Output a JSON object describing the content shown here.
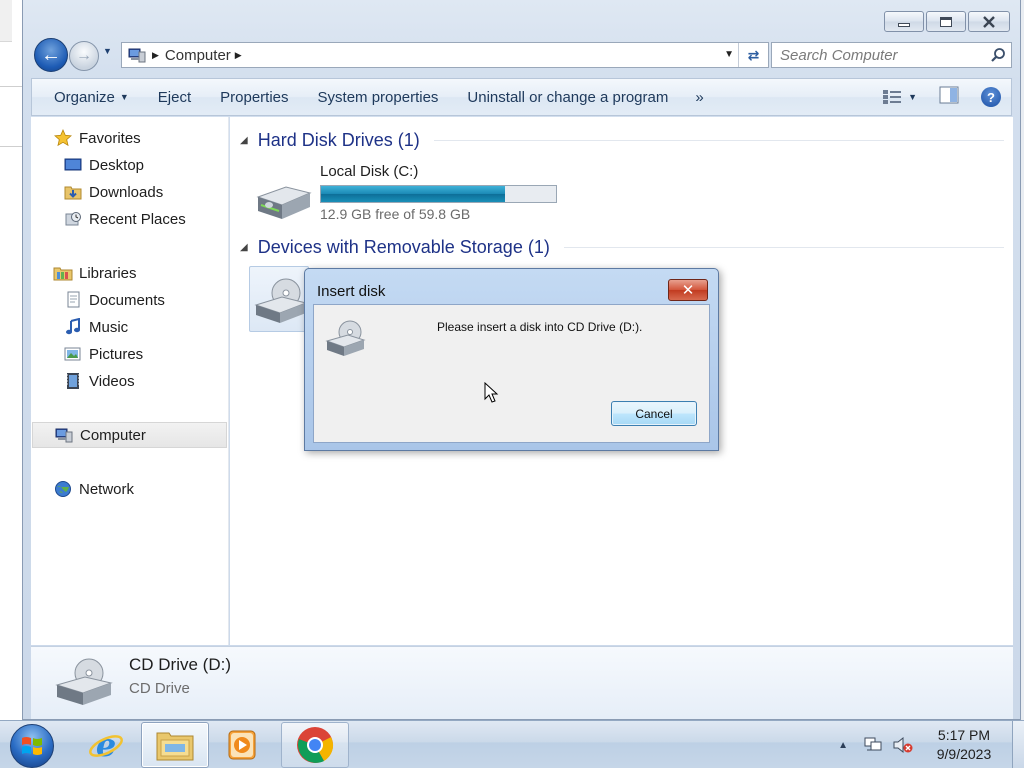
{
  "window": {
    "address": {
      "location": "Computer"
    },
    "search": {
      "placeholder": "Search Computer"
    }
  },
  "command_bar": {
    "organize": "Organize",
    "eject": "Eject",
    "properties": "Properties",
    "system_properties": "System properties",
    "uninstall": "Uninstall or change a program",
    "more": "»"
  },
  "nav": {
    "favorites": "Favorites",
    "desktop": "Desktop",
    "downloads": "Downloads",
    "recent_places": "Recent Places",
    "libraries": "Libraries",
    "documents": "Documents",
    "music": "Music",
    "pictures": "Pictures",
    "videos": "Videos",
    "computer": "Computer",
    "network": "Network"
  },
  "content": {
    "hdd_group": "Hard Disk Drives (1)",
    "removable_group": "Devices with Removable Storage (1)",
    "local_disk": {
      "name": "Local Disk (C:)",
      "free_text": "12.9 GB free of 59.8 GB",
      "used_fraction": 0.784
    }
  },
  "details": {
    "name": "CD Drive (D:)",
    "type": "CD Drive"
  },
  "dialog": {
    "title": "Insert disk",
    "close_glyph": "✕",
    "message": "Please insert a disk into CD Drive (D:).",
    "cancel": "Cancel"
  },
  "taskbar": {
    "time": "5:17 PM",
    "date": "9/9/2023"
  },
  "colors": {
    "group_header": "#1e3287",
    "capacity_bar": "#1b89b5",
    "dialog_frame": "#a9c5e8"
  }
}
